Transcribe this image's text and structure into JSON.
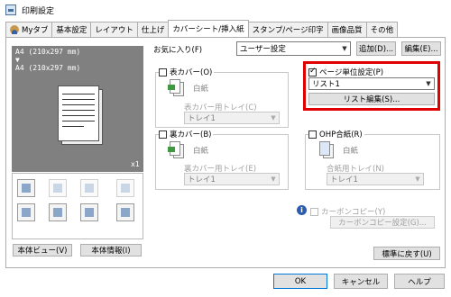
{
  "window": {
    "title": "印刷設定"
  },
  "tabs": [
    {
      "label": "Myタブ",
      "has_icon": true
    },
    {
      "label": "基本設定"
    },
    {
      "label": "レイアウト"
    },
    {
      "label": "仕上げ"
    },
    {
      "label": "カバーシート/挿入紙",
      "active": true
    },
    {
      "label": "スタンプ/ページ印字"
    },
    {
      "label": "画像品質"
    },
    {
      "label": "その他"
    }
  ],
  "preview": {
    "paper_line1": "A4 (210x297 mm)",
    "arrow": "▼",
    "paper_line2": "A4 (210x297 mm)",
    "copies": "x1"
  },
  "left_buttons": {
    "printer_view": "本体ビュー(V)",
    "printer_info": "本体情報(I)"
  },
  "favorites": {
    "label": "お気に入り(F)",
    "value": "ユーザー設定",
    "add": "追加(D)...",
    "edit": "編集(E)..."
  },
  "front_cover": {
    "label": "表カバー(O)",
    "paper": "白紙",
    "tray_label": "表カバー用トレイ(C)",
    "tray_value": "トレイ1"
  },
  "back_cover": {
    "label": "裏カバー(B)",
    "paper": "白紙",
    "tray_label": "裏カバー用トレイ(E)",
    "tray_value": "トレイ1"
  },
  "per_page": {
    "label": "ページ単位設定(P)",
    "value": "リスト1",
    "edit_button": "リスト編集(S)..."
  },
  "ohp": {
    "label": "OHP合紙(R)",
    "paper": "白紙",
    "tray_label": "合紙用トレイ(N)",
    "tray_value": "トレイ1"
  },
  "carbon": {
    "label": "カーボンコピー(Y)",
    "settings_button": "カーボンコピー設定(G)...",
    "info_glyph": "i"
  },
  "defaults_button": "標準に戻す(U)",
  "footer": {
    "ok": "OK",
    "cancel": "キャンセル",
    "help": "ヘルプ"
  },
  "colors": {
    "highlight": "#e00000",
    "preview_bg": "#808080"
  }
}
